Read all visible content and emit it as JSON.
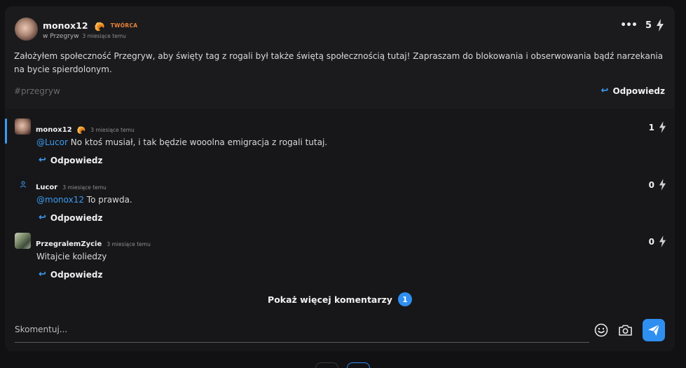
{
  "post": {
    "author": "monox12",
    "author_emoji": "🥐",
    "author_badge": "TWÓRCA",
    "community_prefix": "w Przegryw",
    "time": "3 miesiące temu",
    "more_label": "•••",
    "votes": "5",
    "body": "Założyłem społeczność Przegryw, aby święty tag z rogali był także świętą społecznością tutaj! Zapraszam do blokowania i obserwowania bądź narzekania na bycie spierdolonym.",
    "tag": "#przegryw",
    "reply_label": "Odpowiedz"
  },
  "comments": [
    {
      "author": "monox12",
      "emoji": "🥐",
      "time": "3 miesiące temu",
      "mention": "@Lucor",
      "text": " No ktoś musiał, i tak będzie wooolna emigracja z rogali tutaj.",
      "votes": "1",
      "reply_label": "Odpowiedz"
    },
    {
      "author": "Lucor",
      "emoji": "",
      "time": "3 miesiące temu",
      "mention": "@monox12",
      "text": " To prawda.",
      "votes": "0",
      "reply_label": "Odpowiedz"
    },
    {
      "author": "PrzegralemZycie",
      "emoji": "",
      "time": "3 miesiące temu",
      "mention": "",
      "text": "Witajcie koliedzy",
      "votes": "0",
      "reply_label": "Odpowiedz"
    }
  ],
  "more_comments": {
    "label": "Pokaż więcej komentarzy",
    "count": "1"
  },
  "comment_input": {
    "placeholder": "Skomentuj..."
  },
  "colors": {
    "accent": "#2f8ff0",
    "badge": "#e8833a",
    "background": "#1b1b1d"
  },
  "icons": {
    "vote": "bolt-icon",
    "reply": "reply-arrow-icon",
    "emoji": "smiley-icon",
    "camera": "camera-icon",
    "send": "paper-plane-icon",
    "more": "more-dots-icon"
  }
}
